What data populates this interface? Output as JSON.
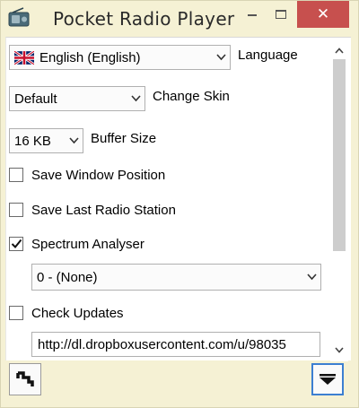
{
  "window": {
    "title": "Pocket Radio Player",
    "close_glyph": "✕"
  },
  "settings": {
    "language": {
      "value": "English (English)",
      "label": "Language",
      "flag": "uk-flag"
    },
    "skin": {
      "value": "Default",
      "label": "Change Skin"
    },
    "buffer": {
      "value": "16 KB",
      "label": "Buffer Size"
    },
    "save_window_position": {
      "label": "Save Window Position",
      "checked": false
    },
    "save_last_station": {
      "label": "Save Last Radio Station",
      "checked": false
    },
    "spectrum": {
      "label": "Spectrum Analyser",
      "checked": true
    },
    "spectrum_mode": {
      "value": "0 - (None)"
    },
    "check_updates": {
      "label": "Check Updates",
      "checked": false
    },
    "update_url": {
      "value": "http://dl.dropboxusercontent.com/u/98035"
    }
  },
  "icons": {
    "app": "radio-icon",
    "compact": "compact-mode-icon",
    "collapse": "collapse-arrow-icon"
  },
  "colors": {
    "window_bg": "#f5f1d4",
    "close_button": "#c7504e",
    "focus_border": "#3c7fd1"
  }
}
